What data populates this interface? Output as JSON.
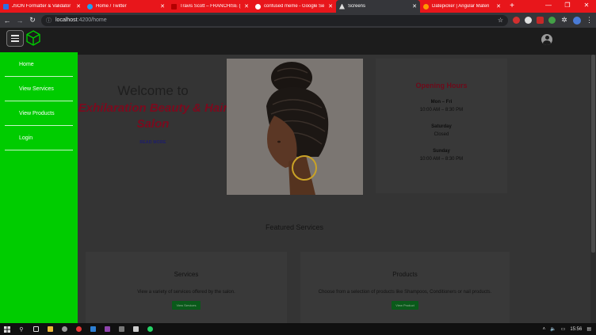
{
  "browser": {
    "tabs": [
      {
        "title": "JSON Formatter & Validator",
        "icon": "checkbox-icon",
        "color": "#2f6fe0",
        "active": false
      },
      {
        "title": "Home / Twitter",
        "icon": "twitter-icon",
        "color": "#1da1f2",
        "active": false
      },
      {
        "title": "Travis Scott – FRANCHISE (Lyr",
        "icon": "youtube-icon",
        "color": "#ff0000",
        "active": false
      },
      {
        "title": "confused meme - Google Se",
        "icon": "google-icon",
        "color": "#ffffff",
        "active": false
      },
      {
        "title": "Screens",
        "icon": "angular-icon",
        "color": "#dddddd",
        "active": true
      },
      {
        "title": "Datepicker | Angular Materi",
        "icon": "angular-material-icon",
        "color": "#ff9800",
        "active": false
      }
    ],
    "address": {
      "host": "localhost",
      "path": ":4200/home"
    }
  },
  "app": {
    "sidebar": {
      "items": [
        "Home",
        "View Services",
        "View Products",
        "Login"
      ]
    },
    "welcome": {
      "line1": "Welcome to",
      "salon_name": "Exhilaration Beauty & Hair Salon",
      "read_more": "READ MORE"
    },
    "hours": {
      "title": "Opening Hours",
      "entries": [
        {
          "day": "Mon – Fri",
          "time": "10:00 AM – 8:30 PM"
        },
        {
          "day": "Saturday",
          "time": "Closed"
        },
        {
          "day": "Sunday",
          "time": "10:00 AM – 8:30 PM"
        }
      ]
    },
    "featured_title": "Featured Services",
    "cards": [
      {
        "title": "Services",
        "text": "View a variety of services offered by the salon.",
        "button": "View Services"
      },
      {
        "title": "Products",
        "text": "Choose from a selection of products like Shampoos, Conditioners or nail products.",
        "button": "View Product"
      }
    ]
  },
  "taskbar": {
    "time": "15:56"
  },
  "colors": {
    "sidebar": "#00cc00",
    "accent": "#7a0b1e",
    "tabstrip": "#e8161b"
  }
}
